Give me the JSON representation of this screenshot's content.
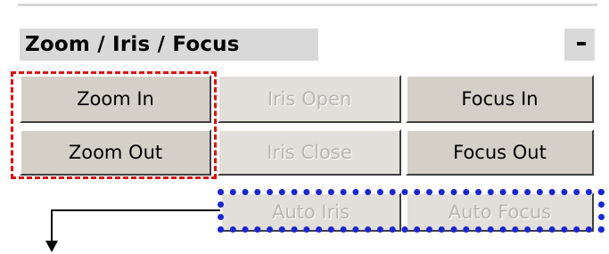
{
  "panel": {
    "title": "Zoom / Iris / Focus",
    "collapse_label": "-"
  },
  "buttons": {
    "zoom_in": "Zoom In",
    "zoom_out": "Zoom Out",
    "iris_open": "Iris Open",
    "iris_close": "Iris Close",
    "focus_in": "Focus In",
    "focus_out": "Focus Out",
    "auto_iris": "Auto Iris",
    "auto_focus": "Auto Focus"
  },
  "states": {
    "iris_open": "disabled",
    "iris_close": "disabled",
    "auto_iris": "disabled",
    "auto_focus": "disabled"
  },
  "colors": {
    "annotation_red": "#e01010",
    "annotation_blue": "#1a25d8",
    "button_face": "#d4d0c8",
    "disabled_text": "#b9b6b0"
  }
}
